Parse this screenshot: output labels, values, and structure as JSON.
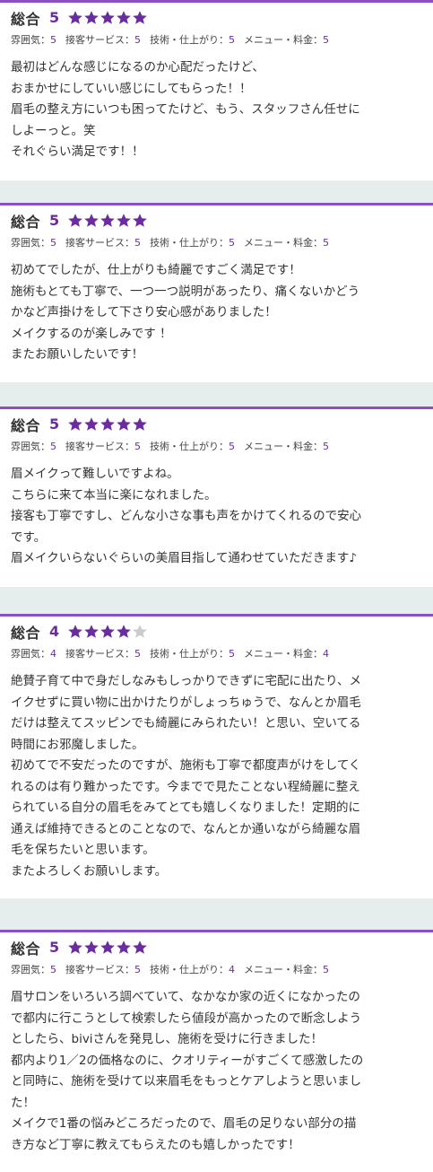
{
  "labels": {
    "overall": "総合",
    "atmosphere": "雰囲気：",
    "service": "接客サービス：",
    "technique": "技術・仕上がり：",
    "menu_price": "メニュー・料金："
  },
  "colors": {
    "accent": "#8a4fc6",
    "score": "#6a2c9e",
    "star_filled": "#6a2c9e",
    "star_empty": "#cccccc",
    "separator": "#e6eded"
  },
  "reviews": [
    {
      "overall": "5",
      "rating": 5,
      "atmosphere": "5",
      "service": "5",
      "technique": "5",
      "menu_price": "5",
      "comment": "最初はどんな感じになるのか心配だったけど、\nおまかせにしていい感じにしてもらった！！\n眉毛の整え方にいつも困ってたけど、もう、スタッフさん任せに\nしよーっと。笑\nそれぐらい満足です！！"
    },
    {
      "overall": "5",
      "rating": 5,
      "atmosphere": "5",
      "service": "5",
      "technique": "5",
      "menu_price": "5",
      "comment": "初めてでしたが、仕上がりも綺麗ですごく満足です！\n施術もとても丁寧で、一つ一つ説明があったり、痛くないかどう\nかなど声掛けをして下さり安心感がありました！\nメイクするのが楽しみです ！\nまたお願いしたいです！"
    },
    {
      "overall": "5",
      "rating": 5,
      "atmosphere": "5",
      "service": "5",
      "technique": "5",
      "menu_price": "5",
      "comment": "眉メイクって難しいですよね。\nこちらに来て本当に楽になれました。\n接客も丁寧ですし、どんな小さな事も声をかけてくれるので安心\nです。\n眉メイクいらないぐらいの美眉目指して通わせていただきます♪"
    },
    {
      "overall": "4",
      "rating": 4,
      "atmosphere": "4",
      "service": "5",
      "technique": "5",
      "menu_price": "4",
      "comment": "絶賛子育て中で身だしなみもしっかりできずに宅配に出たり、メ\nイクせずに買い物に出かけたりがしょっちゅうで、なんとか眉毛\nだけは整えてスッピンでも綺麗にみられたい！と思い、空いてる\n時間にお邪魔しました。\n初めてで不安だったのですが、施術も丁寧で都度声がけをしてく\nれるのは有り難かったです。今までで見たことない程綺麗に整え\nられている自分の眉毛をみてとても嬉しくなりました！定期的に\n通えば維持できるとのことなので、なんとか通いながら綺麗な眉\n毛を保ちたいと思います。\nまたよろしくお願いします。"
    },
    {
      "overall": "5",
      "rating": 5,
      "atmosphere": "5",
      "service": "5",
      "technique": "4",
      "menu_price": "5",
      "comment": "眉サロンをいろいろ調べていて、なかなか家の近くになかったの\nで都内に行こうとして検索したら値段が高かったので断念しよう\nとしたら、biviさんを発見し、施術を受けに行きました！\n都内より1／2の価格なのに、クオリティーがすごくて感激したの\nと同時に、施術を受けて以来眉毛をもっとケアしようと思いまし\nた！\nメイクで1番の悩みどころだったので、眉毛の足りない部分の描\nき方など丁寧に教えてもらえたのも嬉しかったです！"
    }
  ]
}
